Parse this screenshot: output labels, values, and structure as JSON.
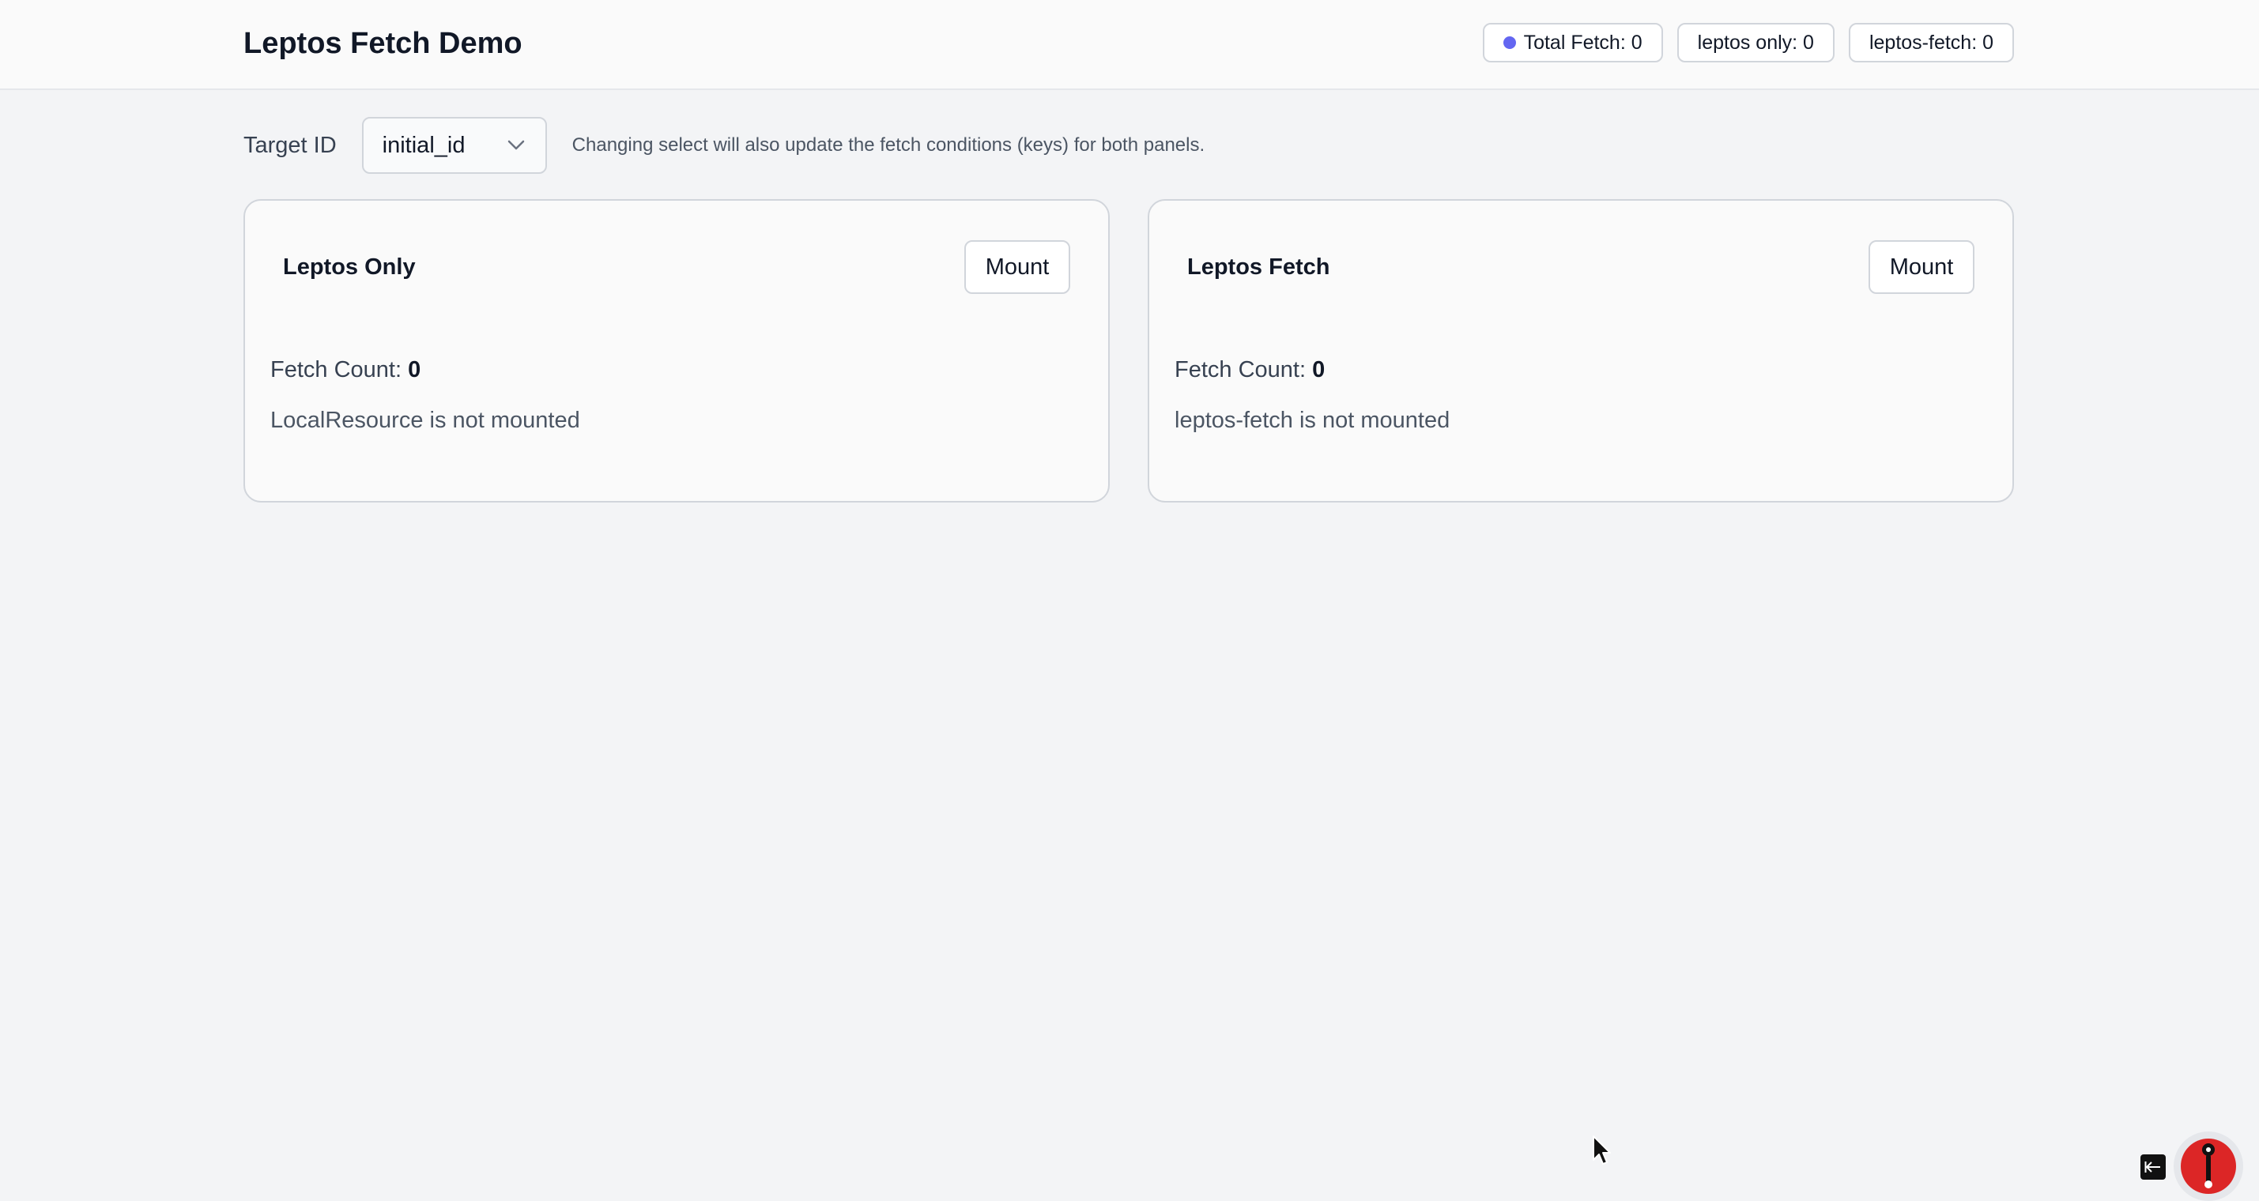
{
  "header": {
    "title": "Leptos Fetch Demo",
    "badges": [
      {
        "label": "Total Fetch: 0",
        "dot_color": "#6366f1"
      },
      {
        "label": "leptos only: 0"
      },
      {
        "label": "leptos-fetch: 0"
      }
    ]
  },
  "controls": {
    "target_label": "Target ID",
    "select_value": "initial_id",
    "hint": "Changing select will also update the fetch conditions (keys) for both panels."
  },
  "panels": [
    {
      "title": "Leptos Only",
      "button_label": "Mount",
      "fetch_label": "Fetch Count:",
      "fetch_count": "0",
      "status": "LocalResource is not mounted"
    },
    {
      "title": "Leptos Fetch",
      "button_label": "Mount",
      "fetch_label": "Fetch Count:",
      "fetch_count": "0",
      "status": "leptos-fetch is not mounted"
    }
  ],
  "devtools": {
    "toggle_icon": "arrow-left-icon",
    "logo_icon": "leptos-devtools-logo-icon",
    "logo_color": "#dc2626"
  },
  "colors": {
    "background": "#f3f4f6",
    "accent_dot": "#6366f1"
  }
}
